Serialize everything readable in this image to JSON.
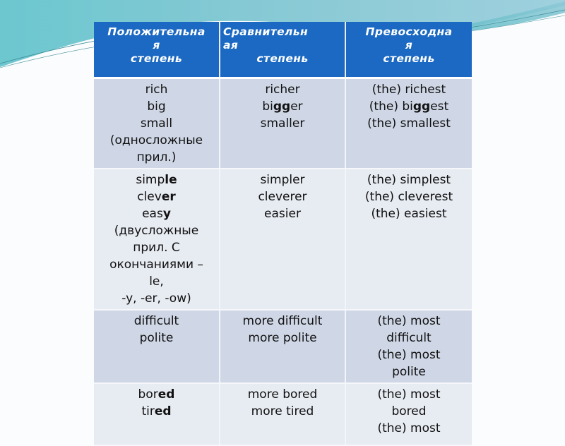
{
  "slide": {
    "accent_color": "#1b69c2",
    "row_dark_color": "#cfd7e6",
    "row_light_color": "#e7ebf2"
  },
  "table": {
    "headers": [
      {
        "lines": [
          "Положительна",
          "я",
          "степень"
        ]
      },
      {
        "lines": [
          "Сравнительн",
          "ая",
          "степень"
        ]
      },
      {
        "lines": [
          "Превосходна",
          "я",
          "степень"
        ]
      }
    ],
    "rows": [
      {
        "cells": [
          {
            "lines": [
              [
                {
                  "t": "rich"
                }
              ],
              [
                {
                  "t": "big"
                }
              ],
              [
                {
                  "t": "small"
                }
              ],
              [
                {
                  "t": "(односложные"
                }
              ],
              [
                {
                  "t": "прил.)"
                }
              ]
            ]
          },
          {
            "lines": [
              [
                {
                  "t": "richer"
                }
              ],
              [
                {
                  "t": "bi"
                },
                {
                  "t": "gg",
                  "b": true
                },
                {
                  "t": "er"
                }
              ],
              [
                {
                  "t": "smaller"
                }
              ]
            ]
          },
          {
            "lines": [
              [
                {
                  "t": "(the) richest"
                }
              ],
              [
                {
                  "t": "(the) bi"
                },
                {
                  "t": "gg",
                  "b": true
                },
                {
                  "t": "est"
                }
              ],
              [
                {
                  "t": "(the) smallest"
                }
              ]
            ]
          }
        ]
      },
      {
        "cells": [
          {
            "lines": [
              [
                {
                  "t": "simp"
                },
                {
                  "t": "le",
                  "b": true
                }
              ],
              [
                {
                  "t": "clev"
                },
                {
                  "t": "er",
                  "b": true
                }
              ],
              [
                {
                  "t": "eas"
                },
                {
                  "t": "y",
                  "b": true
                }
              ],
              [
                {
                  "t": "(двусложные"
                }
              ],
              [
                {
                  "t": "прил. С"
                }
              ],
              [
                {
                  "t": "окончаниями –"
                }
              ],
              [
                {
                  "t": "le,"
                }
              ],
              [
                {
                  "t": "-y, -er, -ow)"
                }
              ]
            ]
          },
          {
            "lines": [
              [
                {
                  "t": "simpler"
                }
              ],
              [
                {
                  "t": "cleverer"
                }
              ],
              [
                {
                  "t": "easier"
                }
              ]
            ]
          },
          {
            "lines": [
              [
                {
                  "t": "(the)  simplest"
                }
              ],
              [
                {
                  "t": "(the)  cleverest"
                }
              ],
              [
                {
                  "t": "(the)  easiest"
                }
              ]
            ]
          }
        ]
      },
      {
        "cells": [
          {
            "lines": [
              [
                {
                  "t": "difficult"
                }
              ],
              [
                {
                  "t": "polite"
                }
              ]
            ]
          },
          {
            "lines": [
              [
                {
                  "t": "more difficult"
                }
              ],
              [
                {
                  "t": "more polite"
                }
              ]
            ]
          },
          {
            "lines": [
              [
                {
                  "t": "(the) most"
                }
              ],
              [
                {
                  "t": "difficult"
                }
              ],
              [
                {
                  "t": "(the)  most"
                }
              ],
              [
                {
                  "t": "polite"
                }
              ]
            ]
          }
        ]
      },
      {
        "cells": [
          {
            "lines": [
              [
                {
                  "t": "bor"
                },
                {
                  "t": "ed",
                  "b": true
                }
              ],
              [
                {
                  "t": "tir"
                },
                {
                  "t": "ed",
                  "b": true
                }
              ]
            ]
          },
          {
            "lines": [
              [
                {
                  "t": "more bored"
                }
              ],
              [
                {
                  "t": "more tired"
                }
              ]
            ]
          },
          {
            "lines": [
              [
                {
                  "t": "(the)  most"
                }
              ],
              [
                {
                  "t": "bored"
                }
              ],
              [
                {
                  "t": "(the)  most"
                }
              ]
            ]
          }
        ]
      }
    ]
  }
}
